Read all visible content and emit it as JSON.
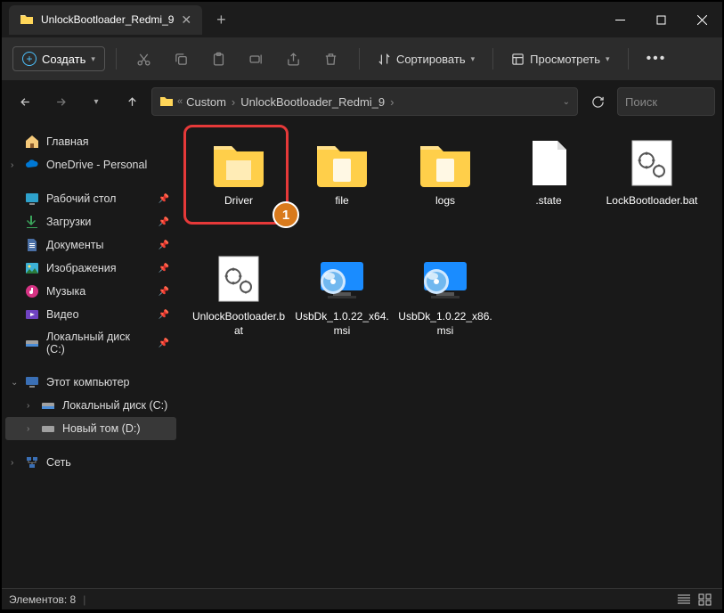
{
  "tab": {
    "title": "UnlockBootloader_Redmi_9"
  },
  "toolbar": {
    "create": "Создать",
    "sort": "Сортировать",
    "view": "Просмотреть"
  },
  "breadcrumb": {
    "parts": [
      "Custom",
      "UnlockBootloader_Redmi_9"
    ]
  },
  "search": {
    "placeholder": "Поиск"
  },
  "sidebar": {
    "home": "Главная",
    "onedrive": "OneDrive - Personal",
    "desktop": "Рабочий стол",
    "downloads": "Загрузки",
    "documents": "Документы",
    "pictures": "Изображения",
    "music": "Музыка",
    "videos": "Видео",
    "localc": "Локальный диск (C:)",
    "thispc": "Этот компьютер",
    "localc2": "Локальный диск (C:)",
    "newvol": "Новый том (D:)",
    "network": "Сеть"
  },
  "items": [
    {
      "name": "Driver",
      "type": "folder"
    },
    {
      "name": "file",
      "type": "folder"
    },
    {
      "name": "logs",
      "type": "folder"
    },
    {
      "name": ".state",
      "type": "file"
    },
    {
      "name": "LockBootloader.bat",
      "type": "bat"
    },
    {
      "name": "UnlockBootloader.bat",
      "type": "bat"
    },
    {
      "name": "UsbDk_1.0.22_x64.msi",
      "type": "msi"
    },
    {
      "name": "UsbDk_1.0.22_x86.msi",
      "type": "msi"
    }
  ],
  "status": {
    "count": "Элементов: 8"
  },
  "annotation": {
    "badge": "1"
  }
}
